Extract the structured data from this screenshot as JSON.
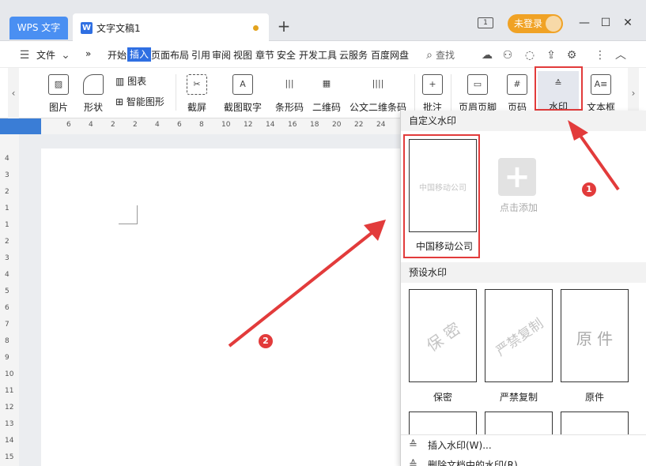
{
  "titlebar": {
    "app_tab": "WPS 文字",
    "doc_tab_icon": "W",
    "doc_tab": "文字文稿1",
    "square_icon": "1",
    "login": "未登录",
    "add_tab": "+",
    "minimize": "—",
    "maximize": "☐",
    "close": "✕"
  },
  "menubar": {
    "file": "文件",
    "more": "»",
    "items": [
      "开始",
      "插入",
      "页面布局",
      "引用",
      "审阅",
      "视图",
      "章节",
      "安全",
      "开发工具",
      "云服务",
      "百度网盘"
    ],
    "active": "插入",
    "search": "查找"
  },
  "ribbon": {
    "picture": "图片",
    "shape": "形状",
    "chart": "图表",
    "smart_graphic": "智能图形",
    "screenshot": "截屏",
    "ocr": "截图取字",
    "barcode": "条形码",
    "qrcode": "二维码",
    "gongwen": "公文二维条码",
    "comment": "批注",
    "header_footer": "页眉页脚",
    "page_number": "页码",
    "watermark": "水印",
    "textbox": "文本框",
    "icon_shot": "✂",
    "icon_ocr": "A",
    "icon_bar": "|||",
    "icon_qr": "▦",
    "icon_gw": "||||",
    "icon_comment": "+",
    "icon_hf": "▭",
    "icon_pn": "#",
    "icon_wm": "≙",
    "icon_tb": "A≡"
  },
  "ruler": {
    "top": [
      "6",
      "4",
      "2",
      "2",
      "4",
      "6",
      "8",
      "10",
      "12",
      "14",
      "16",
      "18",
      "20",
      "22",
      "24"
    ],
    "left": [
      "4",
      "3",
      "2",
      "1",
      "1",
      "2",
      "3",
      "4",
      "5",
      "6",
      "7",
      "8",
      "9",
      "10",
      "11",
      "12",
      "13",
      "14",
      "15"
    ]
  },
  "watermark_panel": {
    "custom_section": "自定义水印",
    "custom_item": {
      "preview": "中国移动公司",
      "label": "中国移动公司"
    },
    "add_label": "点击添加",
    "preset_section": "预设水印",
    "presets": [
      {
        "preview": "保 密",
        "label": "保密"
      },
      {
        "preview": "严禁复制",
        "label": "严禁复制"
      },
      {
        "preview": "原 件",
        "label": "原件"
      }
    ],
    "insert_item": "插入水印(W)...",
    "remove_item": "删除文档中的水印(R)"
  },
  "annotations": {
    "callout_1": "1",
    "callout_2": "2"
  },
  "colors": {
    "accent": "#2f6fe2",
    "highlight": "#e23b3b",
    "login": "#f0a225"
  }
}
